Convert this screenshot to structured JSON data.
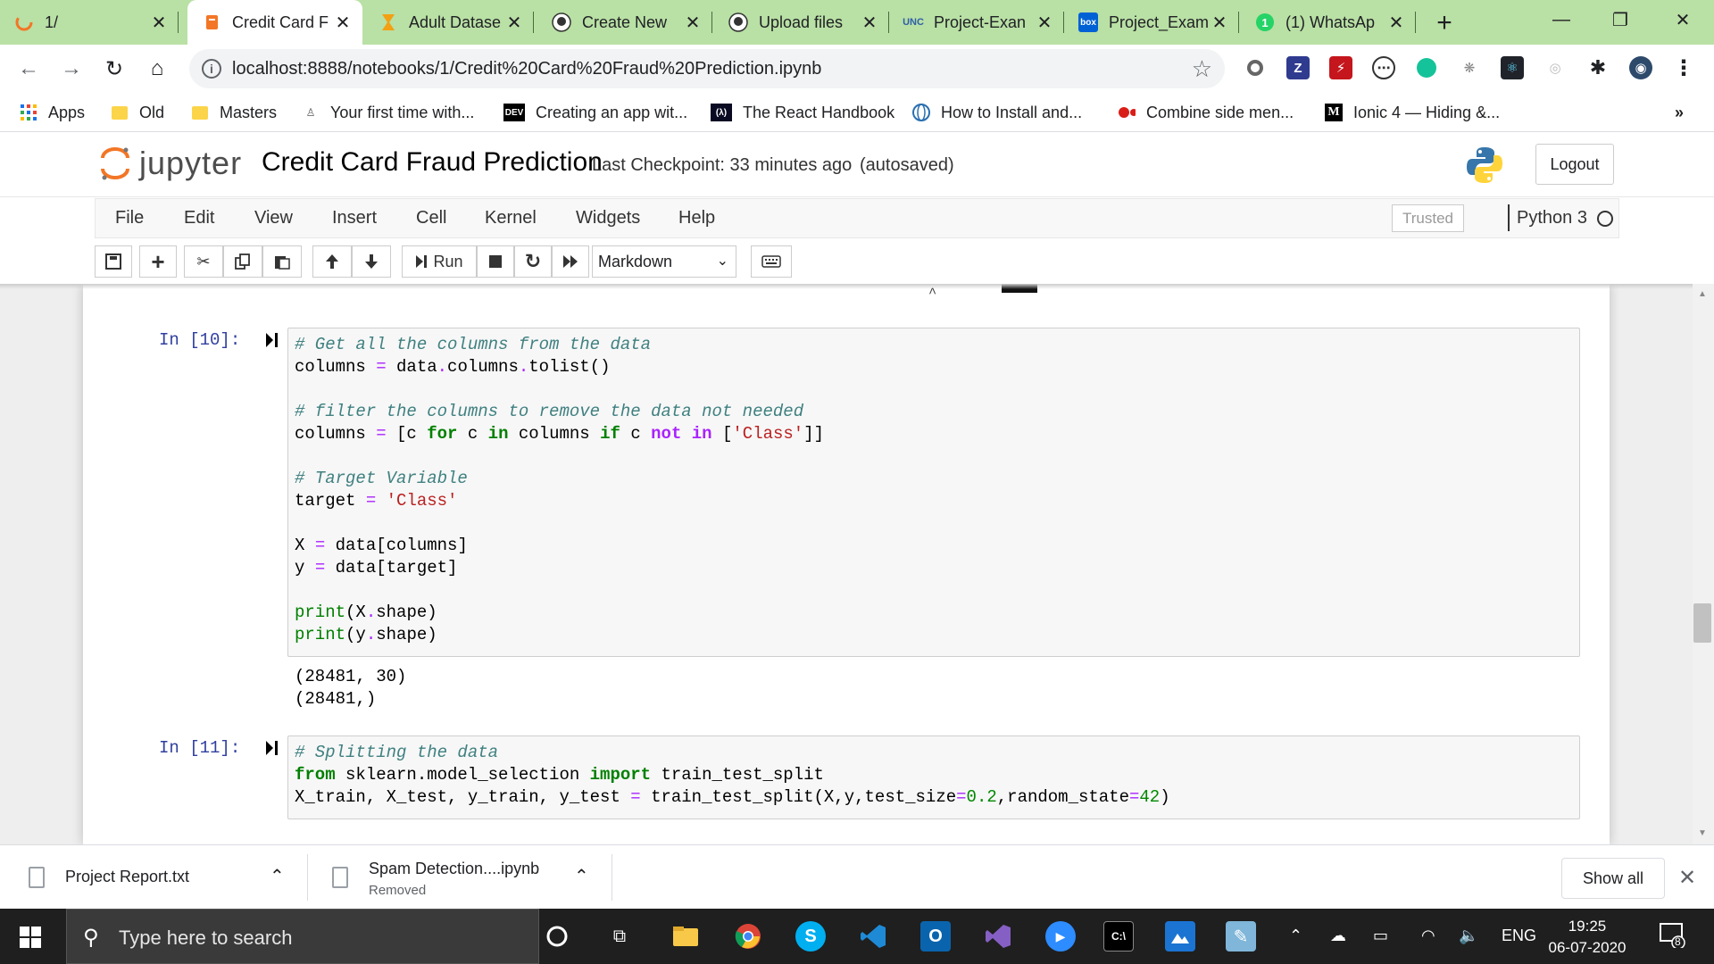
{
  "browser": {
    "tabs": [
      {
        "title": "1/",
        "active": false
      },
      {
        "title": "Credit Card F",
        "active": true
      },
      {
        "title": "Adult Datase",
        "active": false
      },
      {
        "title": "Create New",
        "active": false
      },
      {
        "title": "Upload files",
        "active": false
      },
      {
        "title": "Project-Exan",
        "active": false
      },
      {
        "title": "Project_Exam",
        "active": false
      },
      {
        "title": "(1) WhatsAp",
        "active": false
      }
    ],
    "new_tab": "+",
    "address": "localhost:8888/notebooks/1/Credit%20Card%20Fraud%20Prediction.ipynb",
    "extensions": [
      "Z"
    ],
    "bookmarks": [
      {
        "label": "Apps",
        "icon": "apps-grid-icon"
      },
      {
        "label": "Old",
        "icon": "folder-icon"
      },
      {
        "label": "Masters",
        "icon": "folder-icon"
      },
      {
        "label": "Your first time with...",
        "icon": "page-icon"
      },
      {
        "label": "Creating an app wit...",
        "icon": "dev-icon"
      },
      {
        "label": "The React Handbook",
        "icon": "freecodecamp-icon"
      },
      {
        "label": "How to Install and...",
        "icon": "globe-icon"
      },
      {
        "label": "Combine side men...",
        "icon": "dots-icon"
      },
      {
        "label": "Ionic 4 — Hiding &...",
        "icon": "medium-icon"
      }
    ],
    "bookmarks_overflow": "»"
  },
  "jupyter": {
    "logo_text": "jupyter",
    "notebook_title": "Credit Card Fraud Prediction",
    "checkpoint": "Last Checkpoint: 33 minutes ago",
    "autosave": "(autosaved)",
    "logout": "Logout",
    "menu": [
      "File",
      "Edit",
      "View",
      "Insert",
      "Cell",
      "Kernel",
      "Widgets",
      "Help"
    ],
    "trusted": "Trusted",
    "kernel": "Python 3",
    "toolbar": {
      "run_label": "Run",
      "cell_type": "Markdown"
    }
  },
  "cells": [
    {
      "prompt": "In [10]:",
      "output": "(28481, 30)\n(28481,)"
    },
    {
      "prompt": "In [11]:",
      "output": ""
    }
  ],
  "downloads": [
    {
      "name": "Project Report.txt",
      "status": ""
    },
    {
      "name": "Spam Detection....ipynb",
      "status": "Removed"
    }
  ],
  "downloads_show_all": "Show all",
  "taskbar": {
    "search_placeholder": "Type here to search",
    "language": "ENG",
    "time": "19:25",
    "date": "06-07-2020",
    "notification_count": "8"
  }
}
